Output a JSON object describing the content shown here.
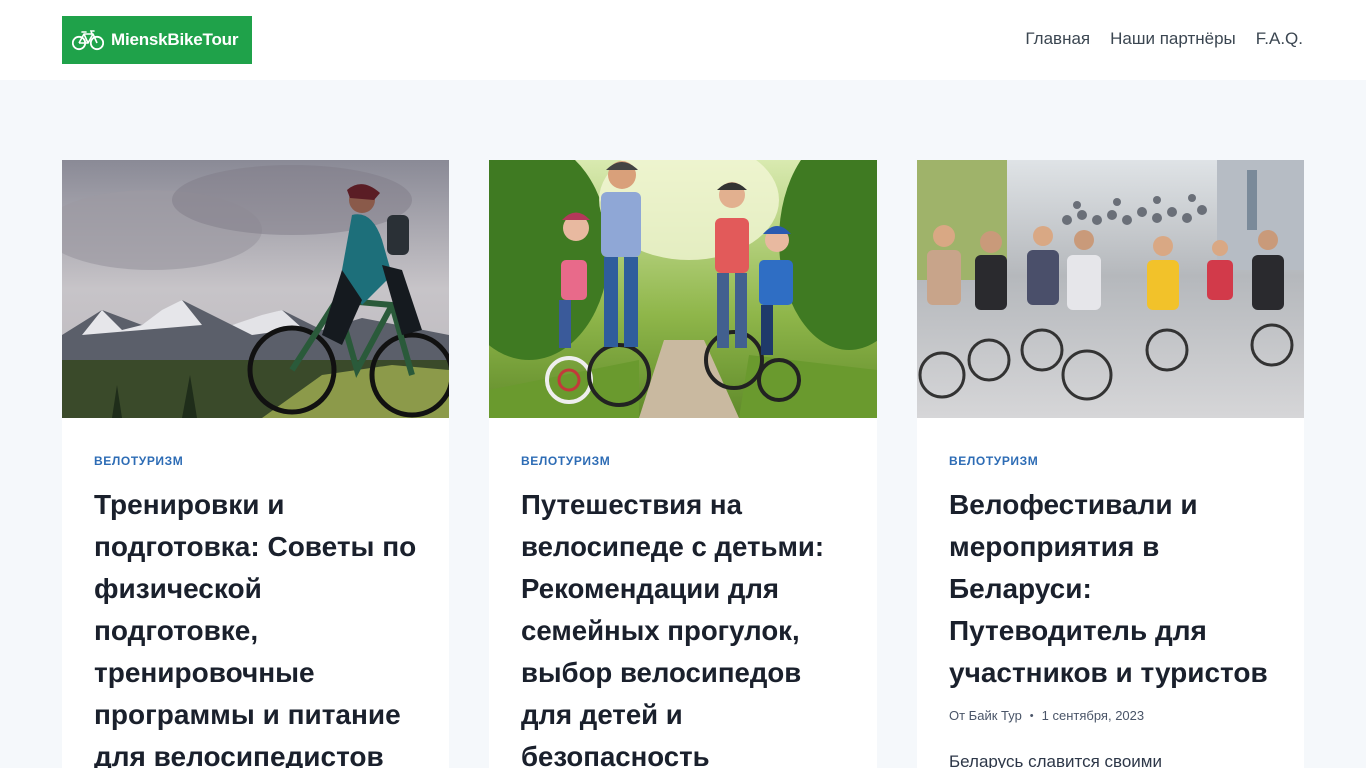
{
  "site": {
    "logo_text": "MienskBikeTour",
    "logo_icon": "bicycle-icon",
    "brand_color": "#1fa24a"
  },
  "nav": {
    "items": [
      {
        "label": "Главная"
      },
      {
        "label": "Наши партнёры"
      },
      {
        "label": "F.A.Q."
      }
    ]
  },
  "posts": [
    {
      "image_subject": "cyclist-mountains-photo",
      "category": "ВЕЛОТУРИЗМ",
      "title": "Тренировки и подготовка: Советы по физической подготовке, тренировочные программы и питание для велосипедистов"
    },
    {
      "image_subject": "family-cycling-photo",
      "category": "ВЕЛОТУРИЗМ",
      "title": "Путешествия на велосипеде с детьми: Рекомендации для семейных прогулок, выбор велосипедов для детей и безопасность"
    },
    {
      "image_subject": "bike-festival-crowd-photo",
      "category": "ВЕЛОТУРИЗМ",
      "title": "Велофестивали и мероприятия в Беларуси: Путеводитель для участников и туристов",
      "author": "От Байк Тур",
      "date": "1 сентября, 2023",
      "excerpt": "Беларусь славится своими"
    }
  ],
  "colors": {
    "category": "#2d6cb5",
    "page_bg": "#f5f8fb"
  }
}
